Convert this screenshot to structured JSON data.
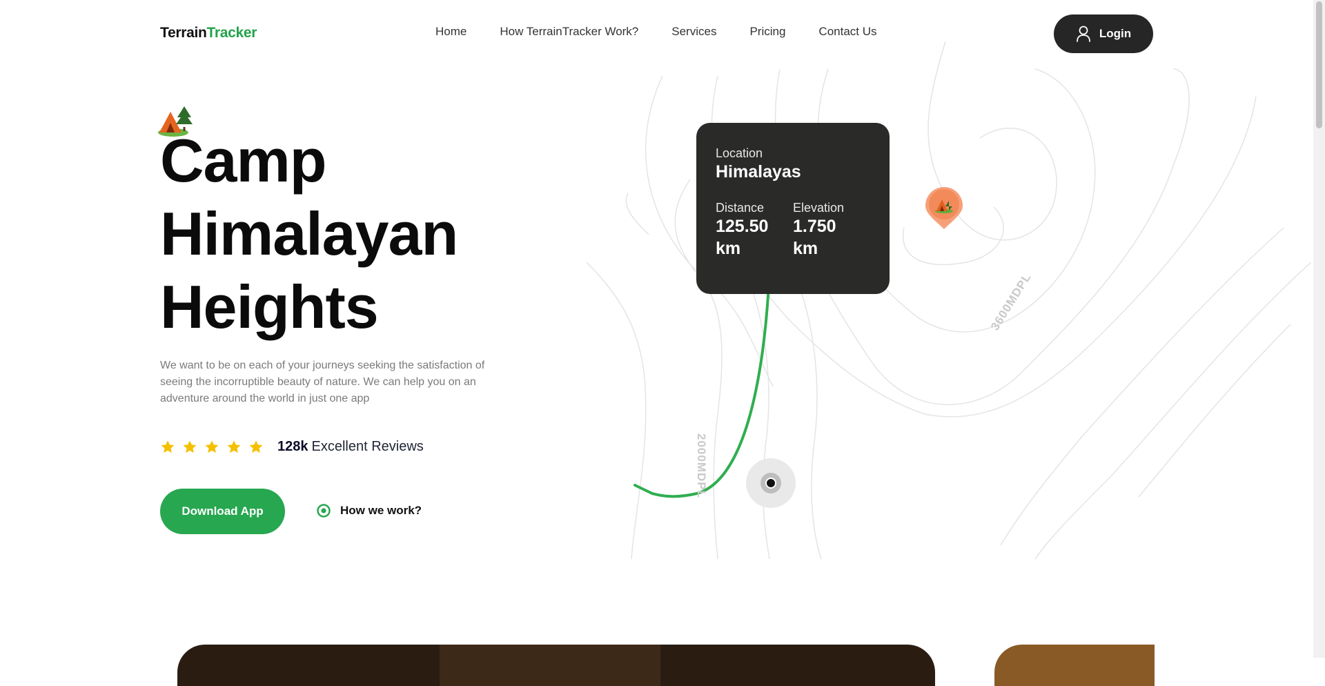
{
  "brand": {
    "part1": "Terrain",
    "part2": "Tracker",
    "accent": "#22a34a"
  },
  "nav": {
    "items": [
      {
        "label": "Home"
      },
      {
        "label": "How TerrainTracker Work?"
      },
      {
        "label": "Services"
      },
      {
        "label": "Pricing"
      },
      {
        "label": "Contact Us"
      }
    ],
    "login_label": "Login",
    "login_icon": "user-icon"
  },
  "hero": {
    "icon": "tent-icon",
    "title_lines": [
      "Camp",
      "Himalayan",
      "Heights"
    ],
    "description": "We want to be on each of your journeys seeking the satisfaction of seeing the incorruptible beauty of nature. We can help you on an adventure around the world in just one app",
    "rating": {
      "stars": 5,
      "count": "128k",
      "label": "Excellent Reviews",
      "star_color": "#f5c000"
    },
    "download_label": "Download App",
    "how_label": "How we work?"
  },
  "map": {
    "card": {
      "location_label": "Location",
      "location_value": "Himalayas",
      "distance_label": "Distance",
      "distance_value": "125.50 km",
      "elevation_label": "Elevation",
      "elevation_value": "1.750 km"
    },
    "contour_labels": [
      "3600MDPL",
      "2000MDPL"
    ],
    "route_color": "#2fae4f",
    "pin_color": "#f28a5a"
  }
}
